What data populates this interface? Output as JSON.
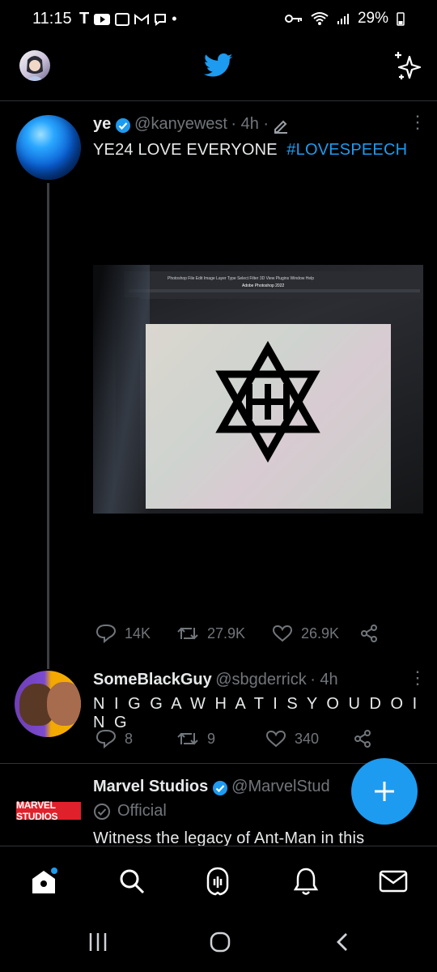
{
  "status_bar": {
    "time": "11:15",
    "battery": "29%"
  },
  "tweets": [
    {
      "name": "ye",
      "handle": "@kanyewest",
      "time": "· 4h ·",
      "text_plain": "YE24 LOVE EVERYONE",
      "hashtag": "#LOVESPEECH",
      "replies": "14K",
      "retweets": "27.9K",
      "likes": "26.9K",
      "photo_texts": {
        "app_title": "Adobe Photoshop 2022",
        "menu": "Photoshop  File  Edit  Image  Layer  Type  Select  Filter  3D  View  Plugins  Window  Help"
      }
    },
    {
      "name": "SomeBlackGuy",
      "handle": "@sbgderrick",
      "time": "· 4h",
      "text_plain": "N I G G A W H A T I S Y O U D O I N G",
      "replies": "8",
      "retweets": "9",
      "likes": "340"
    },
    {
      "name": "Marvel Studios",
      "handle": "@MarvelStud",
      "label": "Official",
      "logo_text": "MARVEL STUDIOS",
      "text_plain": "Witness the legacy of Ant-Man in this"
    }
  ],
  "colors": {
    "accent": "#1d9bf0",
    "background": "#000000",
    "muted": "#71767b"
  },
  "icons": {
    "header": [
      "twitter-bird-icon",
      "sparkle-icon"
    ],
    "nav": [
      "home-icon",
      "search-icon",
      "spaces-icon",
      "notifications-icon",
      "messages-icon"
    ]
  }
}
